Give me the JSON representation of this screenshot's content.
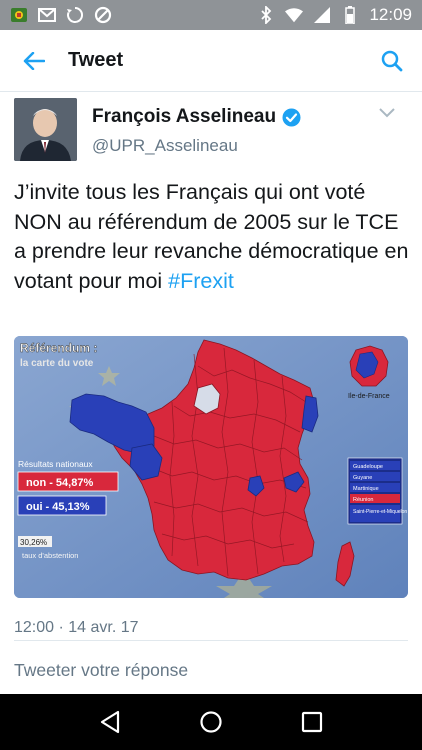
{
  "status_bar": {
    "time": "12:09",
    "left_icons": [
      "app-notification-icon",
      "gmail-icon",
      "sync-icon",
      "blocked-icon"
    ],
    "right_icons": [
      "bluetooth-icon",
      "wifi-icon",
      "signal-icon",
      "battery-icon"
    ]
  },
  "app_bar": {
    "title": "Tweet",
    "back_icon": "back-arrow-icon",
    "search_icon": "search-icon",
    "accent_color": "#1da1f2"
  },
  "tweet": {
    "author_name": "François Asselineau",
    "verified": true,
    "handle": "@UPR_Asselineau",
    "text": "J’invite tous les Français qui ont voté NON au référendum de 2005 sur le TCE a prendre leur revanche démocratique en votant pour moi ",
    "hashtag": "#Frexit",
    "timestamp": "12:00 · 14 avr. 17"
  },
  "media": {
    "title_line1": "Référendum :",
    "title_line2": "la carte du vote",
    "results_heading": "Résultats nationaux",
    "non_label": "non - 54,87%",
    "oui_label": "oui - 45,13%",
    "abstention_value": "30,26%",
    "abstention_label": "taux d'abstention",
    "inset_label": "Ile-de-France",
    "overseas": [
      "Guadeloupe",
      "Guyane",
      "Martinique",
      "Réunion",
      "Saint-Pierre-et-Miquelon"
    ],
    "overseas_colors": [
      "blue",
      "blue",
      "blue",
      "red",
      "blue"
    ],
    "colors": {
      "non": "#d8283c",
      "oui": "#2940b8",
      "background": "#6b8fc4"
    }
  },
  "reply": {
    "placeholder": "Tweeter votre réponse"
  },
  "nav_bar": {
    "icons": [
      "nav-back-icon",
      "nav-home-icon",
      "nav-recents-icon"
    ]
  }
}
